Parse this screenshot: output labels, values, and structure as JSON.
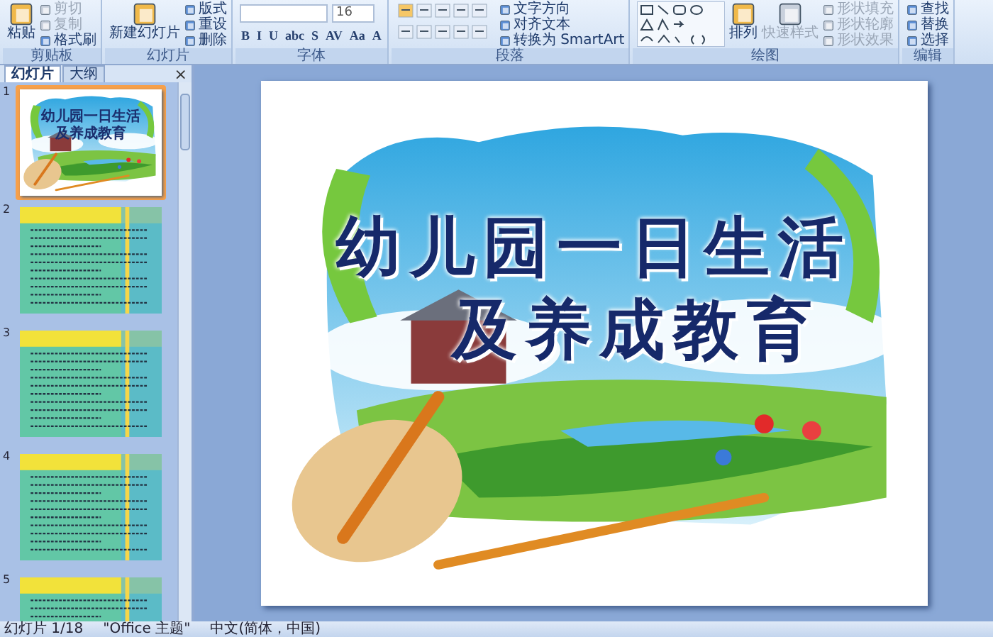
{
  "ribbon": {
    "groups": [
      {
        "label": "剪贴板",
        "columns": [
          {
            "kind": "large",
            "label": "粘贴",
            "disabled": false
          },
          {
            "kind": "small",
            "items": [
              {
                "label": "剪切",
                "disabled": true
              },
              {
                "label": "复制",
                "disabled": true
              },
              {
                "label": "格式刷",
                "disabled": false
              }
            ]
          }
        ]
      },
      {
        "label": "幻灯片",
        "columns": [
          {
            "kind": "large",
            "label": "新建幻灯片",
            "disabled": false
          },
          {
            "kind": "small",
            "items": [
              {
                "label": "版式",
                "disabled": false
              },
              {
                "label": "重设",
                "disabled": false
              },
              {
                "label": "删除",
                "disabled": false
              }
            ]
          }
        ]
      },
      {
        "label": "字体",
        "columns": [
          {
            "kind": "font",
            "size": "16",
            "buttons": [
              "B",
              "I",
              "U",
              "abc",
              "S",
              "AV",
              "Aa",
              "A"
            ]
          }
        ]
      },
      {
        "label": "段落",
        "columns": [
          {
            "kind": "paragraph"
          },
          {
            "kind": "small",
            "items": [
              {
                "label": "文字方向",
                "disabled": false
              },
              {
                "label": "对齐文本",
                "disabled": false
              },
              {
                "label": "转换为 SmartArt",
                "disabled": false
              }
            ]
          }
        ]
      },
      {
        "label": "绘图",
        "columns": [
          {
            "kind": "shapes"
          },
          {
            "kind": "large",
            "label": "排列",
            "disabled": false
          },
          {
            "kind": "large",
            "label": "快速样式",
            "disabled": true
          },
          {
            "kind": "small",
            "items": [
              {
                "label": "形状填充",
                "disabled": true
              },
              {
                "label": "形状轮廓",
                "disabled": true
              },
              {
                "label": "形状效果",
                "disabled": true
              }
            ]
          }
        ]
      },
      {
        "label": "编辑",
        "columns": [
          {
            "kind": "small",
            "items": [
              {
                "label": "查找",
                "disabled": false
              },
              {
                "label": "替换",
                "disabled": false
              },
              {
                "label": "选择",
                "disabled": false
              }
            ]
          }
        ]
      }
    ]
  },
  "panel": {
    "tabs": [
      {
        "label": "幻灯片",
        "selected": true
      },
      {
        "label": "大纲",
        "selected": false
      }
    ],
    "close": "×",
    "slides": [
      {
        "number": "1",
        "selected": true,
        "kind": "title",
        "lines": [
          "幼儿园一日生活",
          "及养成教育"
        ]
      },
      {
        "number": "2",
        "selected": false,
        "kind": "text"
      },
      {
        "number": "3",
        "selected": false,
        "kind": "text"
      },
      {
        "number": "4",
        "selected": false,
        "kind": "text"
      },
      {
        "number": "5",
        "selected": false,
        "kind": "text"
      }
    ]
  },
  "slide": {
    "title_lines": [
      "幼儿园一日生活",
      "及养成教育"
    ]
  },
  "status_bar": [
    "幻灯片 1/18",
    "\"Office 主题\"",
    "中文(简体，中国)"
  ]
}
